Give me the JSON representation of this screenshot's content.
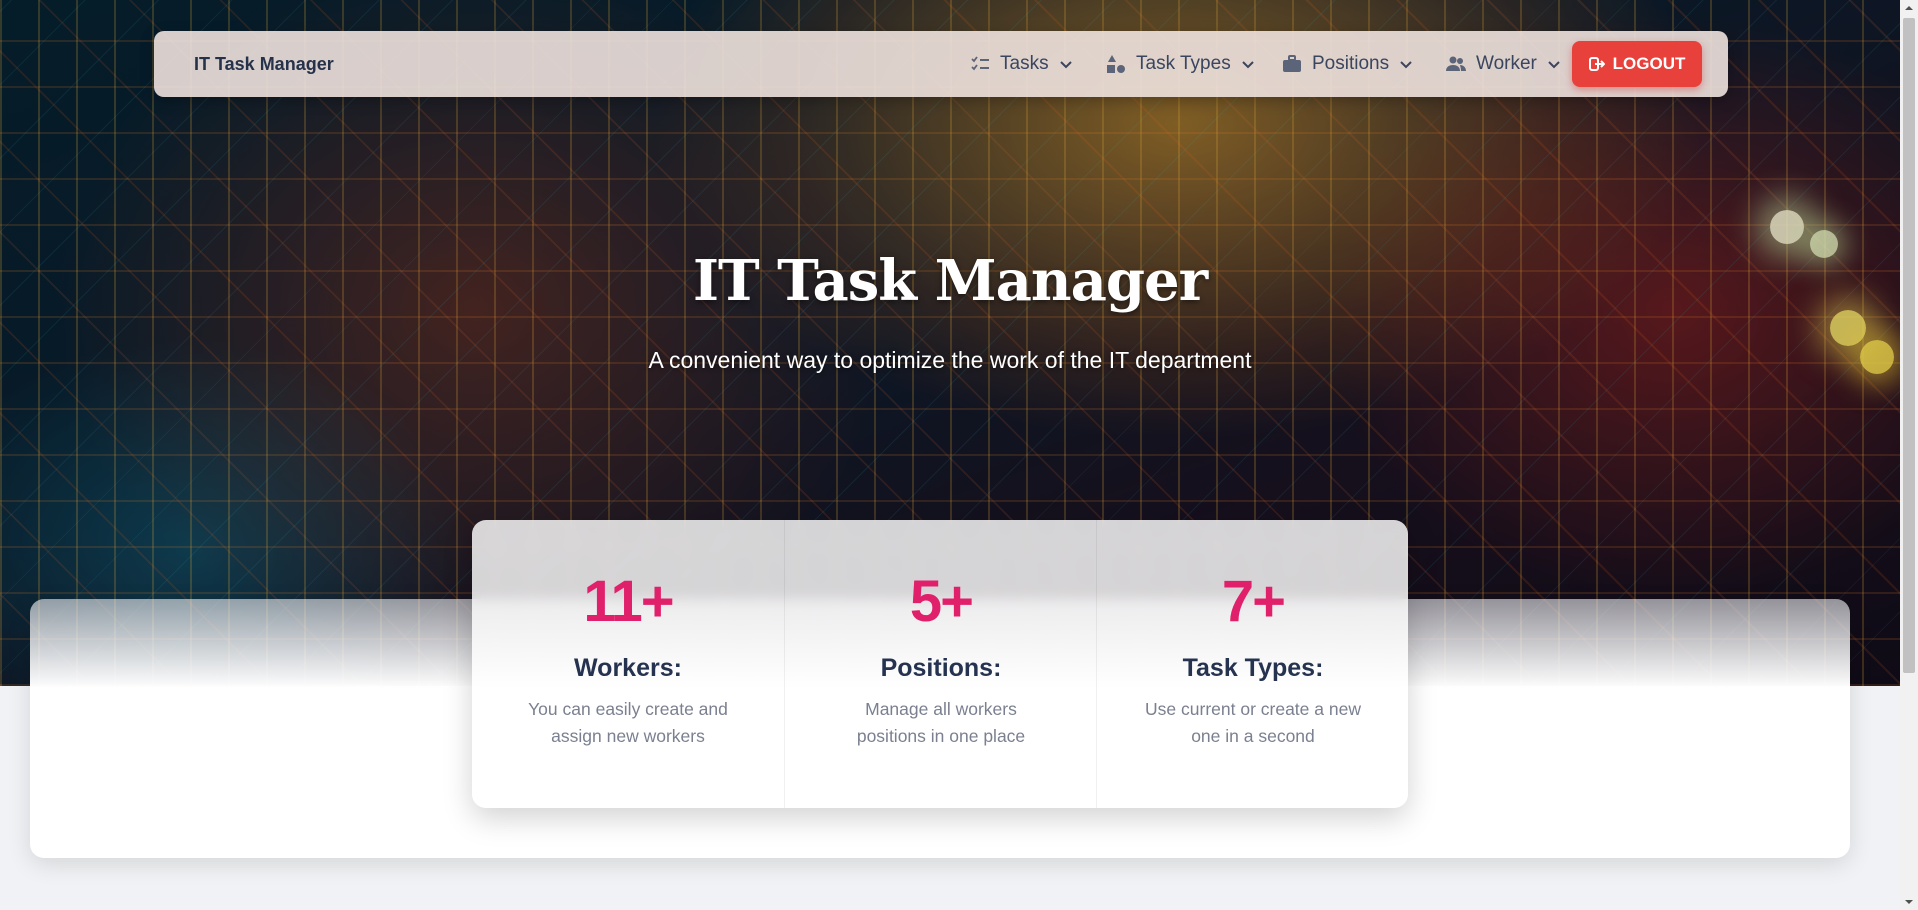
{
  "navbar": {
    "brand": "IT Task Manager",
    "items": [
      {
        "label": "Tasks",
        "icon": "checklist-icon"
      },
      {
        "label": "Task Types",
        "icon": "shapes-icon"
      },
      {
        "label": "Positions",
        "icon": "briefcase-icon"
      },
      {
        "label": "Worker",
        "icon": "users-icon"
      }
    ],
    "logout_label": "LOGOUT"
  },
  "hero": {
    "title": "IT Task Manager",
    "subtitle": "A convenient way to optimize the work of the IT department"
  },
  "stats": [
    {
      "number": "11+",
      "label": "Workers:",
      "description": "You can easily create and assign new workers"
    },
    {
      "number": "5+",
      "label": "Positions:",
      "description": "Manage all workers positions in one place"
    },
    {
      "number": "7+",
      "label": "Task Types:",
      "description": "Use current or create a new one in a second"
    }
  ],
  "colors": {
    "accent": "#e0206a",
    "logout": "#e8413c",
    "heading": "#253350"
  }
}
